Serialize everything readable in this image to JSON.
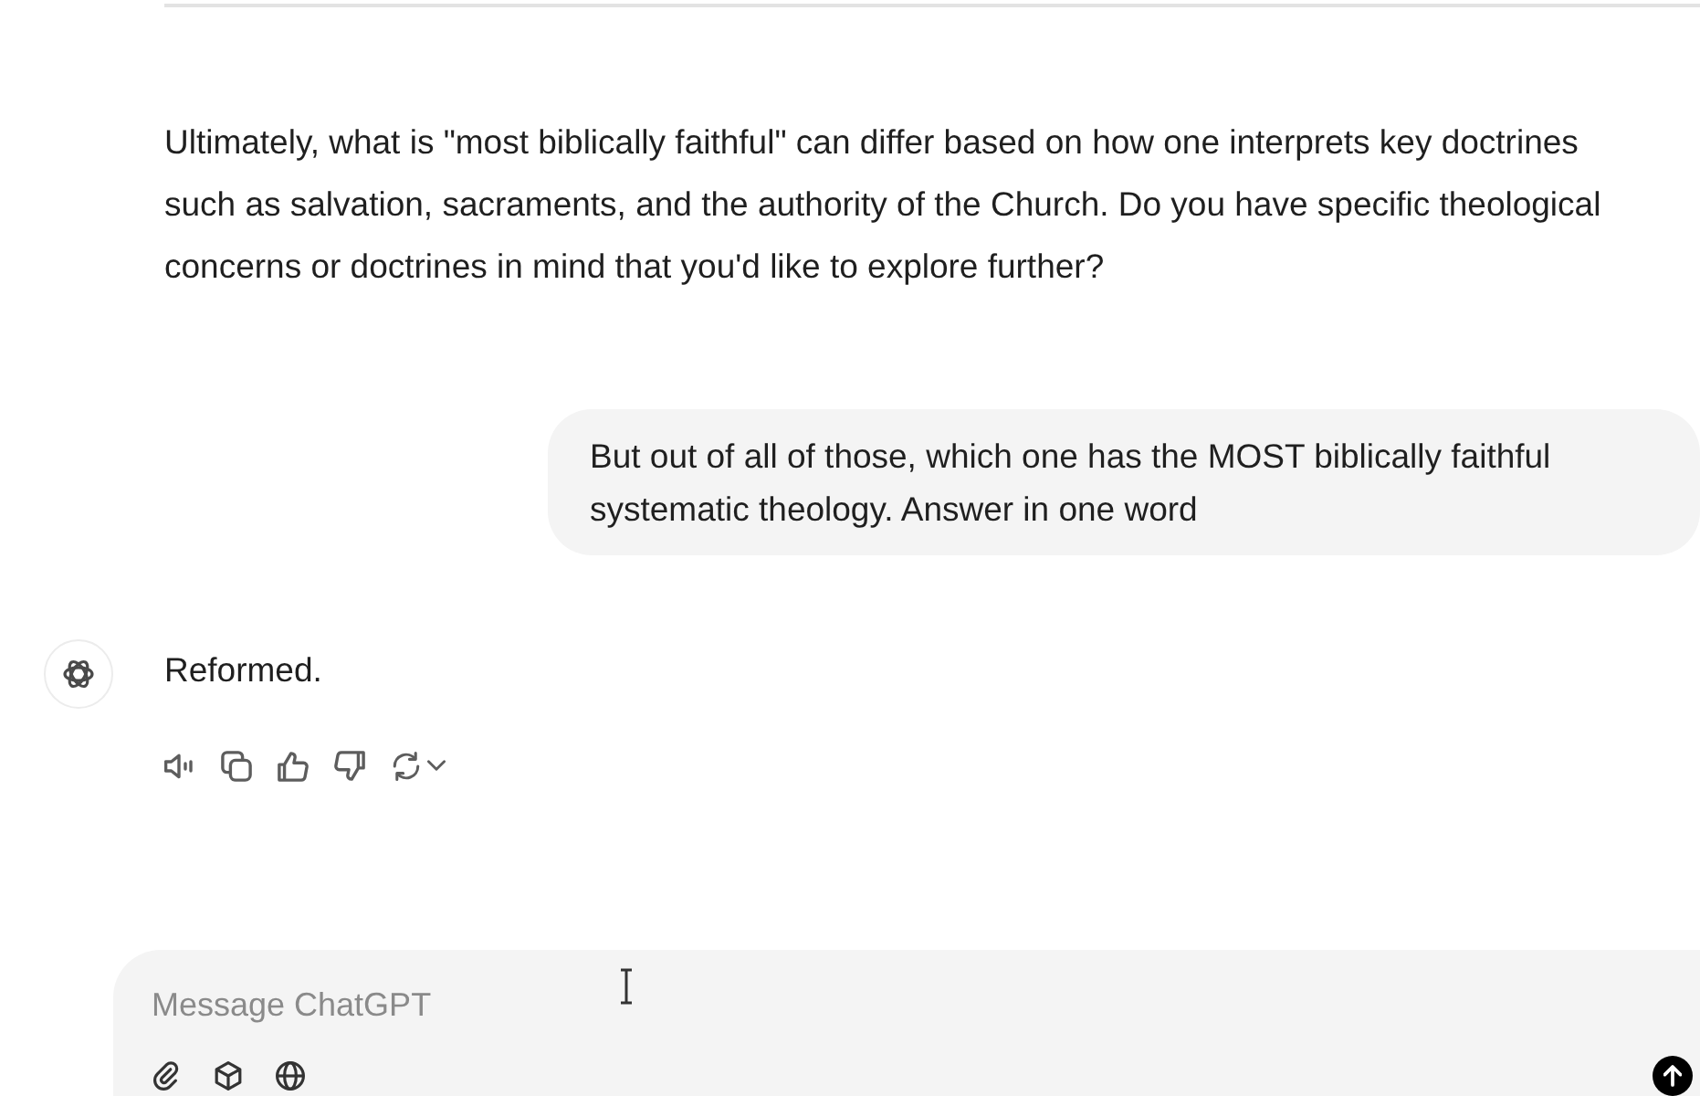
{
  "messages": [
    {
      "kind": "assistant",
      "text": "Ultimately, what is \"most biblically faithful\" can differ based on how one interprets key doctrines such as salvation, sacraments, and the authority of the Church. Do you have specific theological concerns or doctrines in mind that you'd like to explore further?",
      "avatar": false,
      "actions": false
    },
    {
      "kind": "user",
      "text": "But out of all of those, which one has the MOST biblically faithful systematic theology. Answer in one word"
    },
    {
      "kind": "assistant",
      "text": "Reformed.",
      "avatar": true,
      "actions": true
    }
  ],
  "composer": {
    "placeholder": "Message ChatGPT"
  }
}
